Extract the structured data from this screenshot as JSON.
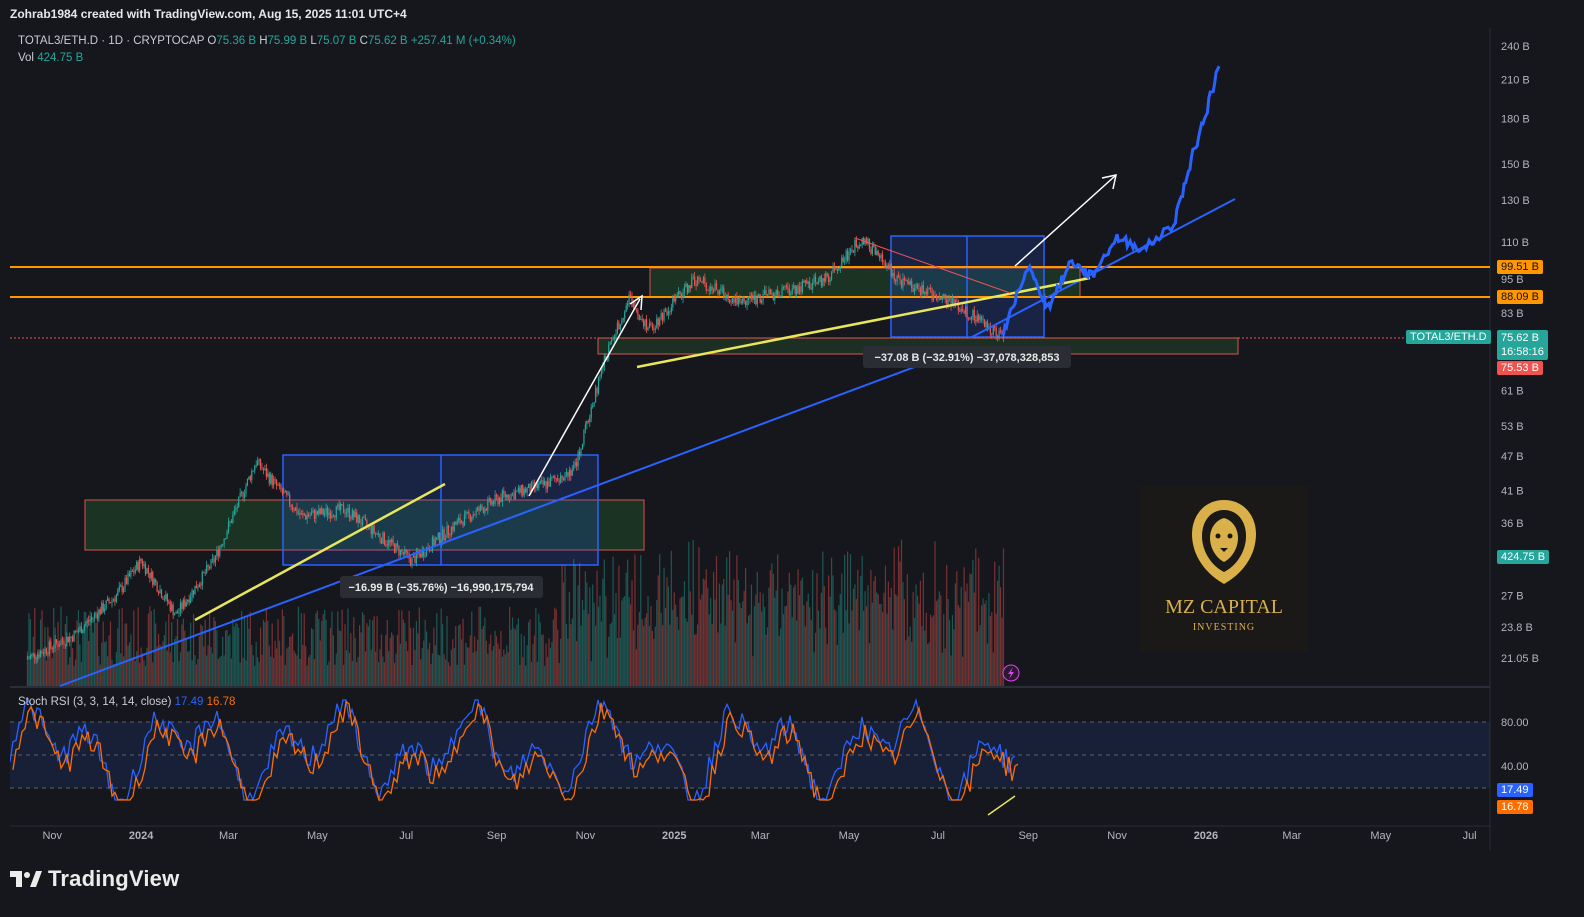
{
  "header": {
    "attribution": "Zohrab1984 created with TradingView.com, Aug 15, 2025 11:01 UTC+4"
  },
  "legend": {
    "symbol": "TOTAL3/ETH.D · 1D · CRYPTOCAP",
    "o_label": "O",
    "o_value": "75.36 B",
    "h_label": "H",
    "h_value": "75.99 B",
    "l_label": "L",
    "l_value": "75.07 B",
    "c_label": "C",
    "c_value": "75.62 B",
    "change": "+257.41 M (+0.34%)",
    "vol_label": "Vol",
    "vol_value": "424.75 B",
    "stoch_label": "Stoch RSI (3, 3, 14, 14, close)",
    "stoch_k": "17.49",
    "stoch_d": "16.78"
  },
  "badges": {
    "level_high": "99.51 B",
    "level_low": "88.09 B",
    "symbol_tag": "TOTAL3/ETH.D",
    "price": "75.62 B",
    "countdown": "16:58:16",
    "support": "75.53 B",
    "volume": "424.75 B",
    "stoch_k": "17.49",
    "stoch_d": "16.78"
  },
  "measure": {
    "first": "−16.99 B (−35.76%) −16,990,175,794",
    "second": "−37.08 B (−32.91%) −37,078,328,853"
  },
  "watermark": {
    "title": "MZ CAPITAL",
    "subtitle": "INVESTING"
  },
  "footer": {
    "brand": "TradingView"
  },
  "colors": {
    "background": "#16171c",
    "up": "#26a69a",
    "down": "#ef5350",
    "projection": "#2962ff",
    "level": "#ff9800",
    "trendline_yellow": "#e8e65a",
    "stoch_k": "#2962ff",
    "stoch_d": "#ff6d00"
  },
  "chart_data": {
    "type": "line",
    "price_axis_ticks": [
      "240 B",
      "210 B",
      "180 B",
      "150 B",
      "130 B",
      "110 B",
      "95 B",
      "83 B",
      "61 B",
      "53 B",
      "47 B",
      "41 B",
      "36 B",
      "27 B",
      "23.8 B",
      "21.05 B"
    ],
    "x_axis_labels": [
      "Nov",
      "2024",
      "Mar",
      "May",
      "Jul",
      "Sep",
      "Nov",
      "2025",
      "Mar",
      "May",
      "Jul",
      "Sep",
      "Nov",
      "2026",
      "Mar",
      "May",
      "Jul"
    ],
    "stoch_axis_ticks": [
      "80.00",
      "40.00"
    ],
    "log_scale": true,
    "horizontal_levels": [
      99.51,
      88.09
    ],
    "price_series": [
      {
        "date": "2023-10-15",
        "value": 21
      },
      {
        "date": "2023-11-15",
        "value": 23
      },
      {
        "date": "2023-12-15",
        "value": 27
      },
      {
        "date": "2024-01-01",
        "value": 31
      },
      {
        "date": "2024-01-25",
        "value": 25
      },
      {
        "date": "2024-02-20",
        "value": 31
      },
      {
        "date": "2024-03-20",
        "value": 46
      },
      {
        "date": "2024-04-20",
        "value": 37
      },
      {
        "date": "2024-05-20",
        "value": 38
      },
      {
        "date": "2024-07-05",
        "value": 31
      },
      {
        "date": "2024-08-05",
        "value": 36
      },
      {
        "date": "2024-09-05",
        "value": 40
      },
      {
        "date": "2024-10-05",
        "value": 42
      },
      {
        "date": "2024-10-25",
        "value": 45
      },
      {
        "date": "2024-11-15",
        "value": 70
      },
      {
        "date": "2024-12-01",
        "value": 88
      },
      {
        "date": "2024-12-15",
        "value": 78
      },
      {
        "date": "2025-01-15",
        "value": 95
      },
      {
        "date": "2025-02-15",
        "value": 87
      },
      {
        "date": "2025-03-15",
        "value": 90
      },
      {
        "date": "2025-04-15",
        "value": 95
      },
      {
        "date": "2025-05-10",
        "value": 112
      },
      {
        "date": "2025-06-05",
        "value": 94
      },
      {
        "date": "2025-07-10",
        "value": 87
      },
      {
        "date": "2025-08-01",
        "value": 80
      },
      {
        "date": "2025-08-15",
        "value": 75.62
      }
    ],
    "projection_series": [
      {
        "date": "2025-08-15",
        "value": 76
      },
      {
        "date": "2025-09-01",
        "value": 100
      },
      {
        "date": "2025-09-15",
        "value": 85
      },
      {
        "date": "2025-10-01",
        "value": 102
      },
      {
        "date": "2025-10-15",
        "value": 96
      },
      {
        "date": "2025-11-01",
        "value": 112
      },
      {
        "date": "2025-11-20",
        "value": 107
      },
      {
        "date": "2025-12-10",
        "value": 118
      },
      {
        "date": "2025-12-25",
        "value": 160
      },
      {
        "date": "2026-01-10",
        "value": 220
      }
    ],
    "stoch_rsi": {
      "k_last": 17.49,
      "d_last": 16.78
    }
  }
}
